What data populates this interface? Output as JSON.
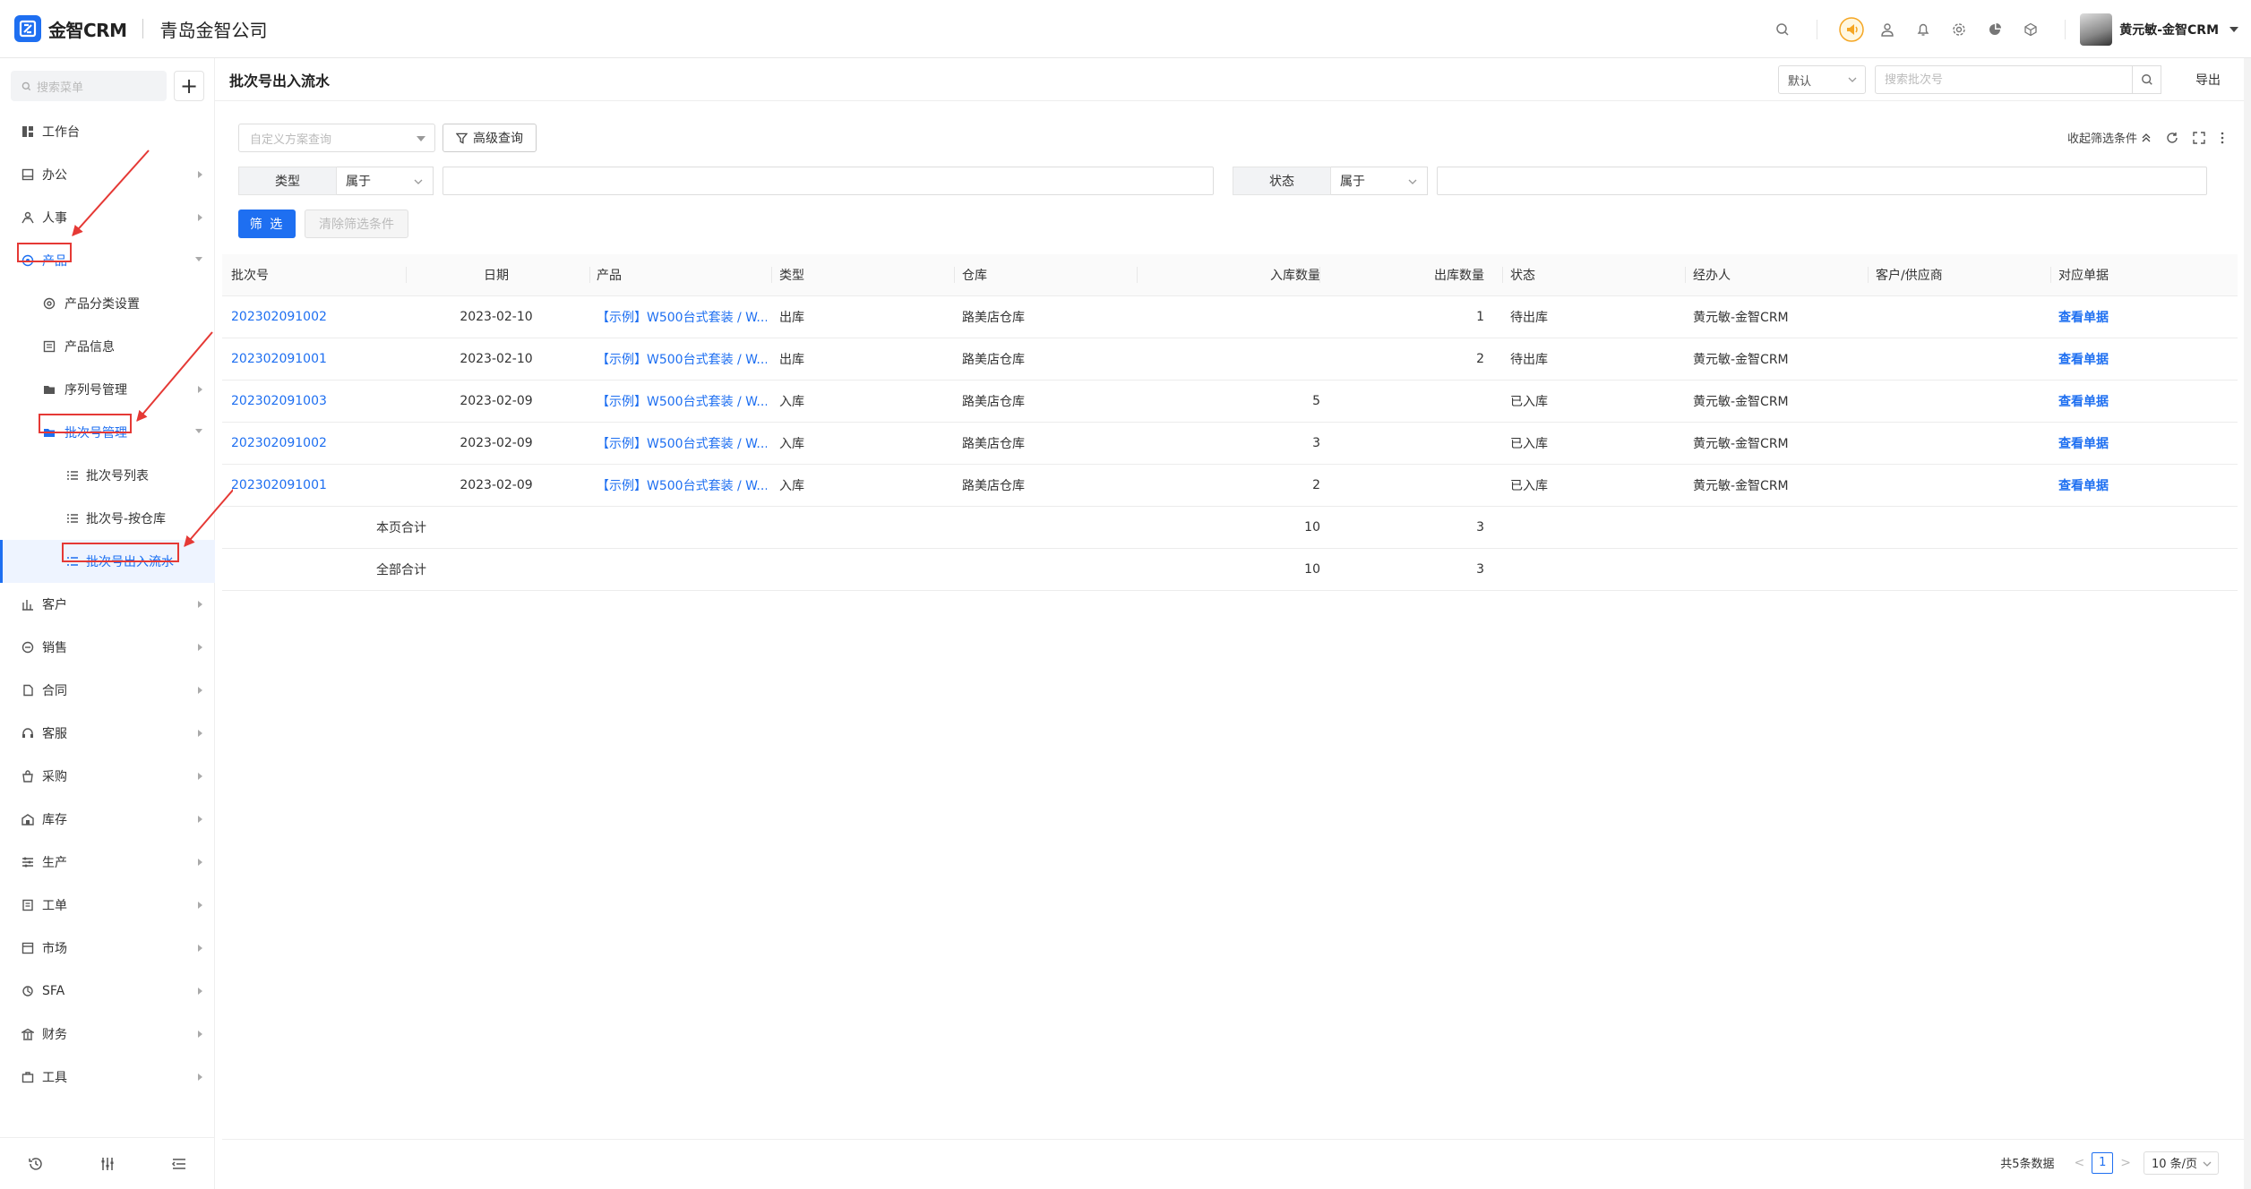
{
  "app": {
    "brand": "金智CRM",
    "company": "青岛金智公司"
  },
  "user": {
    "name": "黄元敏-金智CRM"
  },
  "sidebar": {
    "search_placeholder": "搜索菜单",
    "add_label": "+",
    "items": [
      {
        "label": "工作台",
        "icon": "dashboard-icon"
      },
      {
        "label": "办公",
        "icon": "office-icon"
      },
      {
        "label": "人事",
        "icon": "people-icon"
      },
      {
        "label": "产品",
        "icon": "product-icon"
      },
      {
        "label": "产品分类设置",
        "icon": "settings-icon"
      },
      {
        "label": "产品信息",
        "icon": "info-icon"
      },
      {
        "label": "序列号管理",
        "icon": "folder-icon"
      },
      {
        "label": "批次号管理",
        "icon": "folder-icon"
      },
      {
        "label": "批次号列表",
        "icon": "list-icon"
      },
      {
        "label": "批次号-按仓库",
        "icon": "list-icon"
      },
      {
        "label": "批次号出入流水",
        "icon": "list-icon"
      },
      {
        "label": "客户",
        "icon": "customer-icon"
      },
      {
        "label": "销售",
        "icon": "sales-icon"
      },
      {
        "label": "合同",
        "icon": "contract-icon"
      },
      {
        "label": "客服",
        "icon": "service-icon"
      },
      {
        "label": "采购",
        "icon": "purchase-icon"
      },
      {
        "label": "库存",
        "icon": "inventory-icon"
      },
      {
        "label": "生产",
        "icon": "production-icon"
      },
      {
        "label": "工单",
        "icon": "workorder-icon"
      },
      {
        "label": "市场",
        "icon": "market-icon"
      },
      {
        "label": "SFA",
        "icon": "sfa-icon"
      },
      {
        "label": "财务",
        "icon": "finance-icon"
      },
      {
        "label": "工具",
        "icon": "tools-icon"
      }
    ]
  },
  "page": {
    "title": "批次号出入流水",
    "view_select": "默认",
    "search_placeholder": "搜索批次号",
    "export_label": "导出"
  },
  "filters": {
    "scheme_placeholder": "自定义方案查询",
    "advanced_label": "高级查询",
    "collapse_label": "收起筛选条件",
    "conditions": [
      {
        "label": "类型",
        "op": "属于"
      },
      {
        "label": "状态",
        "op": "属于"
      }
    ],
    "filter_btn": "筛 选",
    "clear_btn": "清除筛选条件"
  },
  "table": {
    "columns": [
      "批次号",
      "日期",
      "产品",
      "类型",
      "仓库",
      "入库数量",
      "出库数量",
      "状态",
      "经办人",
      "客户/供应商",
      "对应单据"
    ],
    "rows": [
      [
        "202302091002",
        "2023-02-10",
        "【示例】W500台式套装 / W...",
        "出库",
        "路美店仓库",
        "",
        "1",
        "待出库",
        "黄元敏-金智CRM",
        "",
        "查看单据"
      ],
      [
        "202302091001",
        "2023-02-10",
        "【示例】W500台式套装 / W...",
        "出库",
        "路美店仓库",
        "",
        "2",
        "待出库",
        "黄元敏-金智CRM",
        "",
        "查看单据"
      ],
      [
        "202302091003",
        "2023-02-09",
        "【示例】W500台式套装 / W...",
        "入库",
        "路美店仓库",
        "5",
        "",
        "已入库",
        "黄元敏-金智CRM",
        "",
        "查看单据"
      ],
      [
        "202302091002",
        "2023-02-09",
        "【示例】W500台式套装 / W...",
        "入库",
        "路美店仓库",
        "3",
        "",
        "已入库",
        "黄元敏-金智CRM",
        "",
        "查看单据"
      ],
      [
        "202302091001",
        "2023-02-09",
        "【示例】W500台式套装 / W...",
        "入库",
        "路美店仓库",
        "2",
        "",
        "已入库",
        "黄元敏-金智CRM",
        "",
        "查看单据"
      ]
    ],
    "summary": [
      {
        "label": "本页合计",
        "in": "10",
        "out": "3"
      },
      {
        "label": "全部合计",
        "in": "10",
        "out": "3"
      }
    ]
  },
  "pager": {
    "total": "共5条数据",
    "prev": "<",
    "page": "1",
    "next": ">",
    "size": "10 条/页"
  },
  "colors": {
    "accent": "#1e6ff1",
    "annotation": "#e53935"
  }
}
